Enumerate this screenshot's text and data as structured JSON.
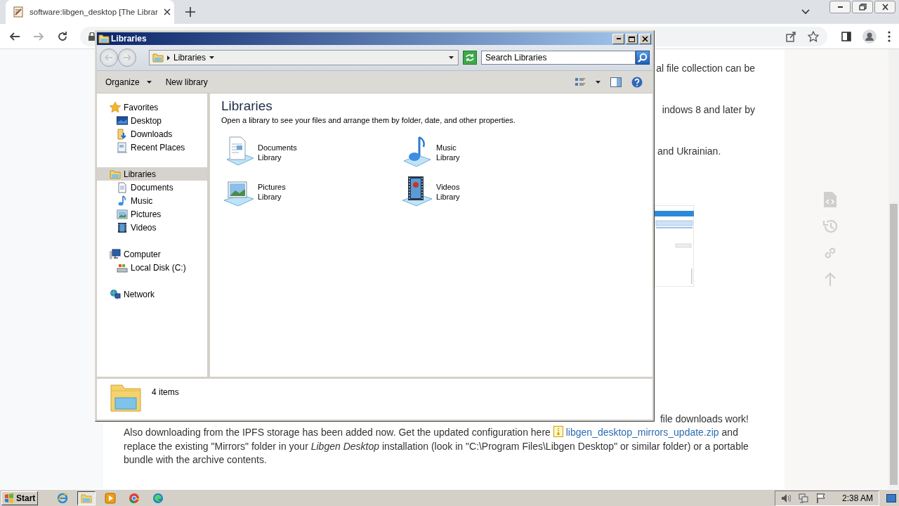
{
  "browser": {
    "tabs": [
      {
        "title": "software:libgen_desktop [The Librar",
        "selected": true
      }
    ],
    "nav_buttons": [
      {
        "kind": "back",
        "disabled": false
      },
      {
        "kind": "forward",
        "disabled": true
      },
      {
        "kind": "reload",
        "disabled": false
      }
    ]
  },
  "page": {
    "fragments": [
      "al file collection can be",
      "indows 8 and later by",
      "and Ukrainian."
    ],
    "notice": {
      "tail": "file downloads work!",
      "before": "Also downloading from the IPFS storage has been added now. Get the updated configuration here ",
      "link": "libgen_desktop_mirrors_update.zip",
      "after": " and replace the existing \"Mirrors\" folder in your *Libgen Desktop* installation (look in \"C:\\Program Files\\Libgen Desktop\" or similar folder) or a portable bundle with the archive contents."
    }
  },
  "explorer": {
    "title": "Libraries",
    "nav_buttons": [
      {
        "kind": "back",
        "disabled": true
      },
      {
        "kind": "forward",
        "disabled": true
      }
    ],
    "breadcrumb": [
      "Libraries"
    ],
    "search": {
      "placeholder": "Search Libraries"
    },
    "commands": [
      {
        "label": "Organize",
        "dropdown": true
      },
      {
        "label": "New library",
        "dropdown": false
      }
    ],
    "nav_tree": [
      {
        "label": "Favorites",
        "selected": false,
        "children": [
          {
            "label": "Desktop",
            "selected": false
          },
          {
            "label": "Downloads",
            "selected": false
          },
          {
            "label": "Recent Places",
            "selected": false
          }
        ]
      },
      {
        "label": "Libraries",
        "selected": true,
        "children": [
          {
            "label": "Documents",
            "selected": false
          },
          {
            "label": "Music",
            "selected": false
          },
          {
            "label": "Pictures",
            "selected": false
          },
          {
            "label": "Videos",
            "selected": false
          }
        ]
      },
      {
        "label": "Computer",
        "selected": false,
        "children": [
          {
            "label": "Local Disk (C:)",
            "selected": false
          }
        ]
      },
      {
        "label": "Network",
        "selected": false
      }
    ],
    "heading": "Libraries",
    "description": "Open a library to see your files and arrange them by folder, date, and other properties.",
    "libraries": [
      {
        "name": "Documents",
        "type": "Library"
      },
      {
        "name": "Music",
        "type": "Library"
      },
      {
        "name": "Pictures",
        "type": "Library"
      },
      {
        "name": "Videos",
        "type": "Library"
      }
    ],
    "status": "4 items"
  },
  "taskbar": {
    "start": "Start",
    "apps": [
      {
        "kind": "ie",
        "selected": false
      },
      {
        "kind": "explorer",
        "selected": true
      },
      {
        "kind": "media",
        "selected": false
      },
      {
        "kind": "chrome",
        "selected": false
      },
      {
        "kind": "edge",
        "selected": false
      }
    ],
    "clock": "2:38 AM"
  }
}
